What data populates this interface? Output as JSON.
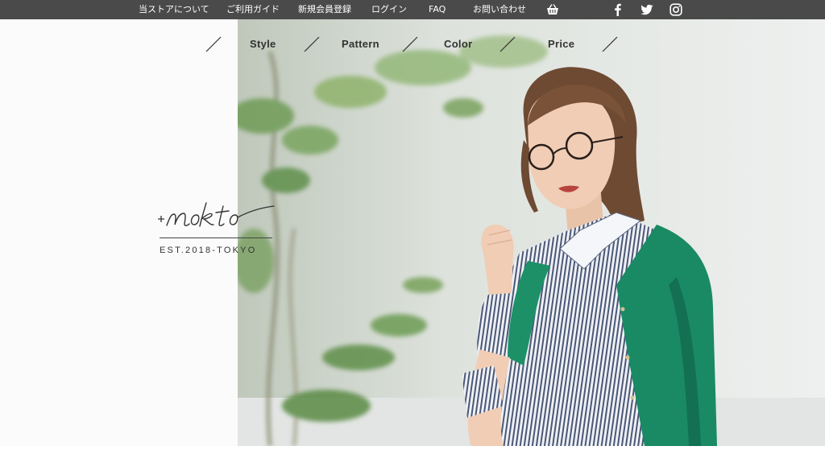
{
  "topbar": {
    "items": [
      {
        "label": "当ストアについて"
      },
      {
        "label": "ご利用ガイド"
      },
      {
        "label": "新規会員登録"
      },
      {
        "label": "ログイン"
      },
      {
        "label": "FAQ"
      },
      {
        "label": "お問い合わせ"
      }
    ],
    "icons": [
      "cart-icon",
      "facebook-icon",
      "twitter-icon",
      "instagram-icon"
    ]
  },
  "category_nav": {
    "items": [
      {
        "label": "Style"
      },
      {
        "label": "Pattern"
      },
      {
        "label": "Color"
      },
      {
        "label": "Price"
      }
    ]
  },
  "logo": {
    "wordmark": "+nokto",
    "tagline": "EST.2018-TOKYO"
  },
  "colors": {
    "topbar_bg": "#4a4a4a",
    "cardigan": "#1a8a64",
    "text": "#333333"
  }
}
